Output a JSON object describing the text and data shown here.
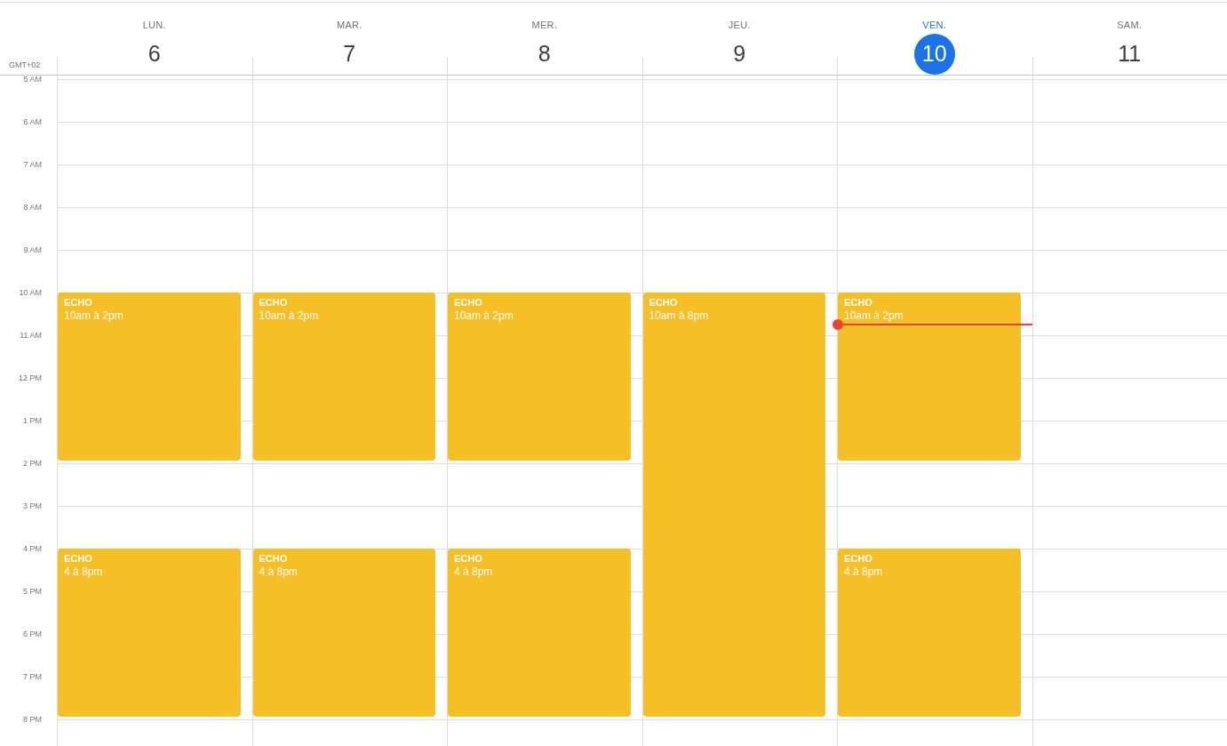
{
  "timezone": "GMT+02",
  "hours": [
    "5 AM",
    "6 AM",
    "7 AM",
    "8 AM",
    "9 AM",
    "10 AM",
    "11 AM",
    "12 PM",
    "1 PM",
    "2 PM",
    "3 PM",
    "4 PM",
    "5 PM",
    "6 PM",
    "7 PM",
    "8 PM"
  ],
  "days": [
    {
      "label": "LUN.",
      "number": "6",
      "today": false,
      "events": [
        {
          "kind": "morning",
          "title": "ECHO",
          "time": "10am à 2pm"
        },
        {
          "kind": "afternoon",
          "title": "ECHO",
          "time": "4 à 8pm"
        }
      ]
    },
    {
      "label": "MAR.",
      "number": "7",
      "today": false,
      "events": [
        {
          "kind": "morning",
          "title": "ECHO",
          "time": "10am à 2pm"
        },
        {
          "kind": "afternoon",
          "title": "ECHO",
          "time": "4 à 8pm"
        }
      ]
    },
    {
      "label": "MER.",
      "number": "8",
      "today": false,
      "events": [
        {
          "kind": "morning",
          "title": "ECHO",
          "time": "10am à 2pm"
        },
        {
          "kind": "afternoon",
          "title": "ECHO",
          "time": "4 à 8pm"
        }
      ]
    },
    {
      "label": "JEU.",
      "number": "9",
      "today": false,
      "events": [
        {
          "kind": "fullday",
          "title": "ECHO",
          "time": "10am à 8pm"
        }
      ]
    },
    {
      "label": "VEN.",
      "number": "10",
      "today": true,
      "events": [
        {
          "kind": "morning",
          "title": "ECHO",
          "time": "10am à 2pm"
        },
        {
          "kind": "afternoon",
          "title": "ECHO",
          "time": "4 à 8pm"
        }
      ]
    },
    {
      "label": "SAM.",
      "number": "11",
      "today": false
    }
  ]
}
